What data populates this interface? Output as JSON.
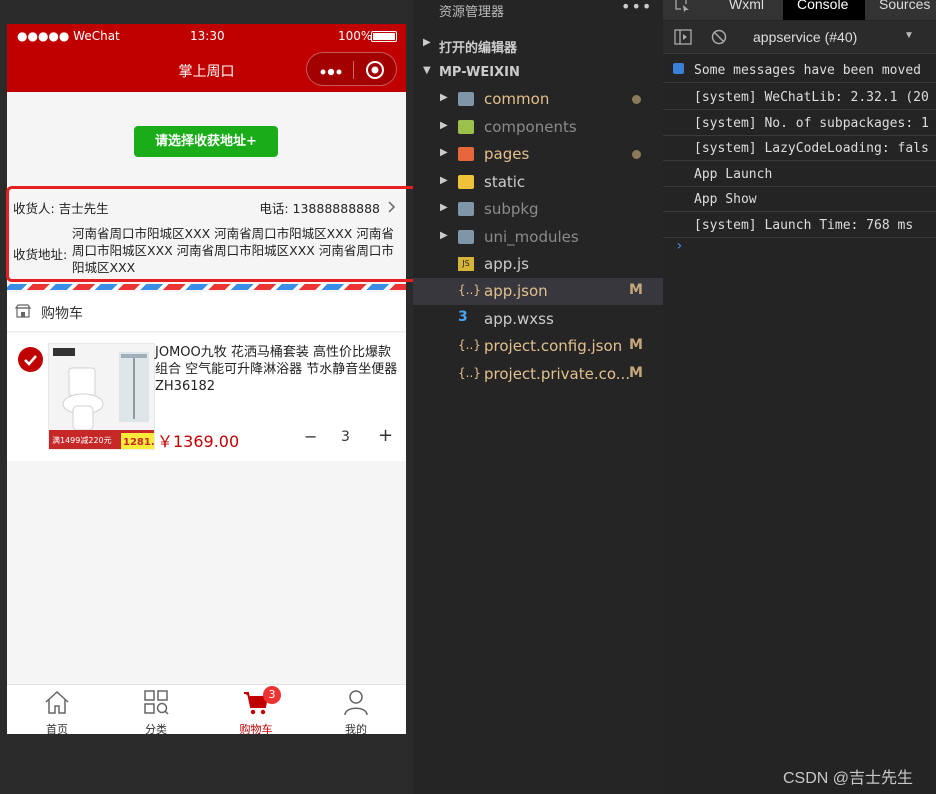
{
  "phone": {
    "status": {
      "carrier": "●●●●● WeChat",
      "time": "13:30",
      "battery": "100%"
    },
    "nav_title": "掌上周口",
    "choose_address_label": "请选择收获地址+",
    "address": {
      "consignee": "收货人: 吉士先生",
      "phone": "电话: 13888888888",
      "label": "收货地址:",
      "text": "河南省周口市阳城区XXX 河南省周口市阳城区XXX 河南省周口市阳城区XXX 河南省周口市阳城区XXX 河南省周口市阳城区XXX"
    },
    "cart_title": "购物车",
    "product": {
      "name": "JOMOO九牧 花洒马桶套装 高性价比爆款组合 空气能可升降淋浴器 节水静音坐便器 ZH36182",
      "price": "￥1369.00",
      "img_promo": "满1499减220元",
      "img_price": "1281.",
      "qty": "3",
      "minus": "−",
      "plus": "+"
    },
    "tabs": [
      {
        "label": "首页",
        "icon": "home-icon"
      },
      {
        "label": "分类",
        "icon": "category-icon"
      },
      {
        "label": "购物车",
        "icon": "cart-icon"
      },
      {
        "label": "我的",
        "icon": "user-icon"
      }
    ],
    "cart_badge": "3",
    "accent": "#c00000"
  },
  "explorer": {
    "title": "资源管理器",
    "more": "•••",
    "open_editors": "打开的编辑器",
    "project": "MP-WEIXIN",
    "files": [
      {
        "name": "common",
        "color": "#e2c08d",
        "mark": "dot"
      },
      {
        "name": "components",
        "color": "#8b8b8b",
        "mark": ""
      },
      {
        "name": "pages",
        "color": "#e2c08d",
        "mark": "dot"
      },
      {
        "name": "static",
        "color": "#cccccc",
        "mark": ""
      },
      {
        "name": "subpkg",
        "color": "#8b8b8b",
        "mark": ""
      },
      {
        "name": "uni_modules",
        "color": "#8b8b8b",
        "mark": ""
      },
      {
        "name": "app.js",
        "color": "#cccccc",
        "mark": ""
      },
      {
        "name": "app.json",
        "color": "#e2c08d",
        "mark": "M"
      },
      {
        "name": "app.wxss",
        "color": "#cccccc",
        "mark": ""
      },
      {
        "name": "project.config.json",
        "color": "#e2c08d",
        "mark": "M"
      },
      {
        "name": "project.private.co...",
        "color": "#e2c08d",
        "mark": "M"
      }
    ]
  },
  "devtools": {
    "tabs": [
      "Wxml",
      "Console",
      "Sources"
    ],
    "context": "appservice (#40)",
    "logs": [
      "Some messages have been moved",
      "[system] WeChatLib: 2.32.1 (20",
      "[system] No. of subpackages: 1",
      "[system] LazyCodeLoading: fals",
      "App Launch",
      "App Show",
      "[system] Launch Time: 768 ms"
    ],
    "prompt": "›"
  },
  "watermark": "CSDN @吉士先生"
}
